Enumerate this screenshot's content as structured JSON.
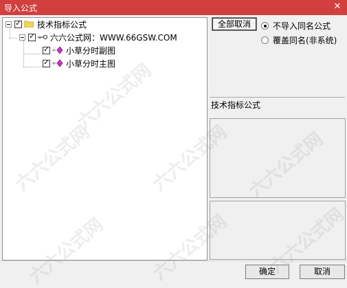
{
  "window": {
    "title": "导入公式",
    "close_glyph": "✕"
  },
  "tree": {
    "root": {
      "label": "技术指标公式",
      "checked": true
    },
    "site": {
      "label": "六六公式网：WWW.66GSW.COM",
      "checked": true
    },
    "children": [
      {
        "label": "小草分时副图",
        "checked": true
      },
      {
        "label": "小草分时主图",
        "checked": true
      }
    ]
  },
  "right": {
    "clear_all_label": "全部取消",
    "radio_options": [
      {
        "label": "不导入同名公式",
        "selected": true
      },
      {
        "label": "覆盖同名(非系统)",
        "selected": false
      }
    ],
    "formula_section_label": "技术指标公式"
  },
  "footer": {
    "ok_label": "确定",
    "cancel_label": "取消"
  },
  "colors": {
    "titlebar": "#d13f3f",
    "folder": "#f2d45c",
    "formula_icon": "#cc2ecc"
  },
  "watermark_text": "六六公式网"
}
